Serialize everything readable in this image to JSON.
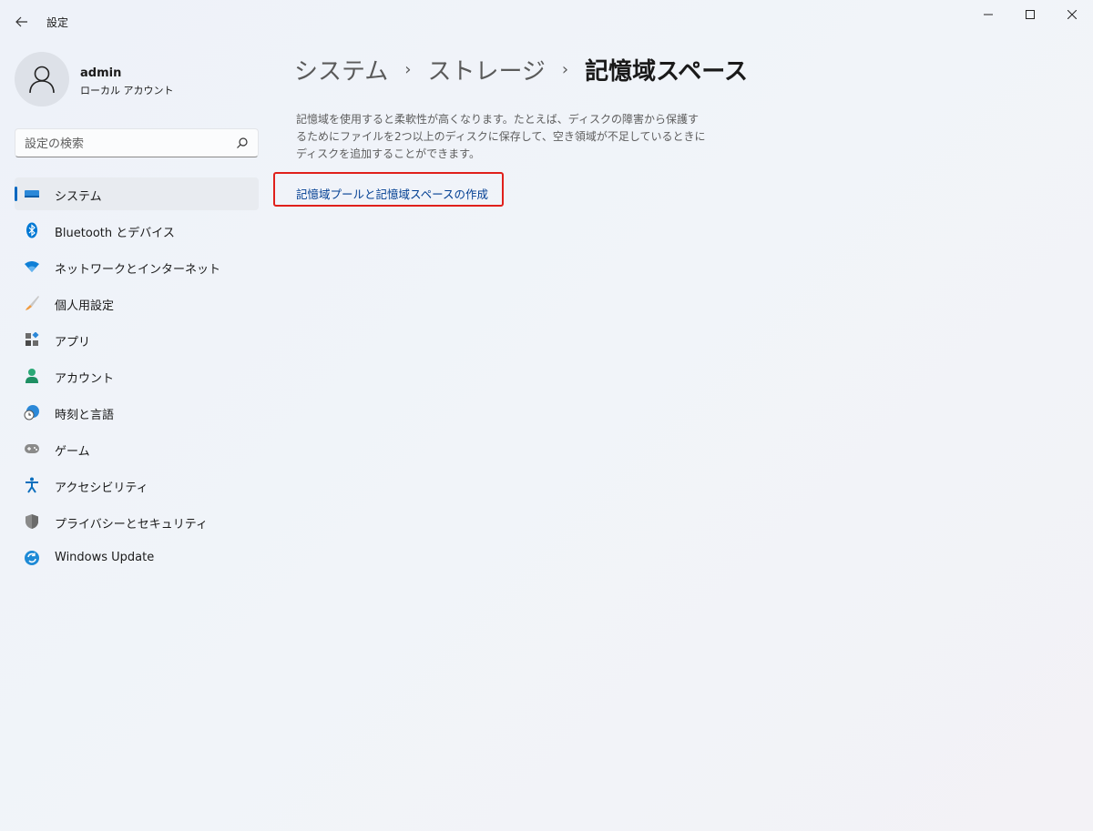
{
  "app": {
    "title": "設定"
  },
  "profile": {
    "name": "admin",
    "account_type": "ローカル アカウント"
  },
  "search": {
    "placeholder": "設定の検索"
  },
  "nav": {
    "items": [
      {
        "label": "システム",
        "icon": "system-icon",
        "active": true
      },
      {
        "label": "Bluetooth とデバイス",
        "icon": "bluetooth-icon"
      },
      {
        "label": "ネットワークとインターネット",
        "icon": "wifi-icon"
      },
      {
        "label": "個人用設定",
        "icon": "brush-icon"
      },
      {
        "label": "アプリ",
        "icon": "apps-icon"
      },
      {
        "label": "アカウント",
        "icon": "person-icon"
      },
      {
        "label": "時刻と言語",
        "icon": "time-language-icon"
      },
      {
        "label": "ゲーム",
        "icon": "gamepad-icon"
      },
      {
        "label": "アクセシビリティ",
        "icon": "accessibility-icon"
      },
      {
        "label": "プライバシーとセキュリティ",
        "icon": "shield-icon"
      },
      {
        "label": "Windows Update",
        "icon": "windows-update-icon"
      }
    ]
  },
  "breadcrumb": {
    "level1": "システム",
    "level2": "ストレージ",
    "current": "記憶域スペース"
  },
  "main": {
    "description": "記憶域を使用すると柔軟性が高くなります。たとえば、ディスクの障害から保護するためにファイルを2つ以上のディスクに保存して、空き領域が不足しているときにディスクを追加することができます。",
    "create_link": "記憶域プールと記憶域スペースの作成"
  },
  "colors": {
    "accent": "#0067c0",
    "link": "#003e92",
    "highlight_box": "#e0201b"
  }
}
